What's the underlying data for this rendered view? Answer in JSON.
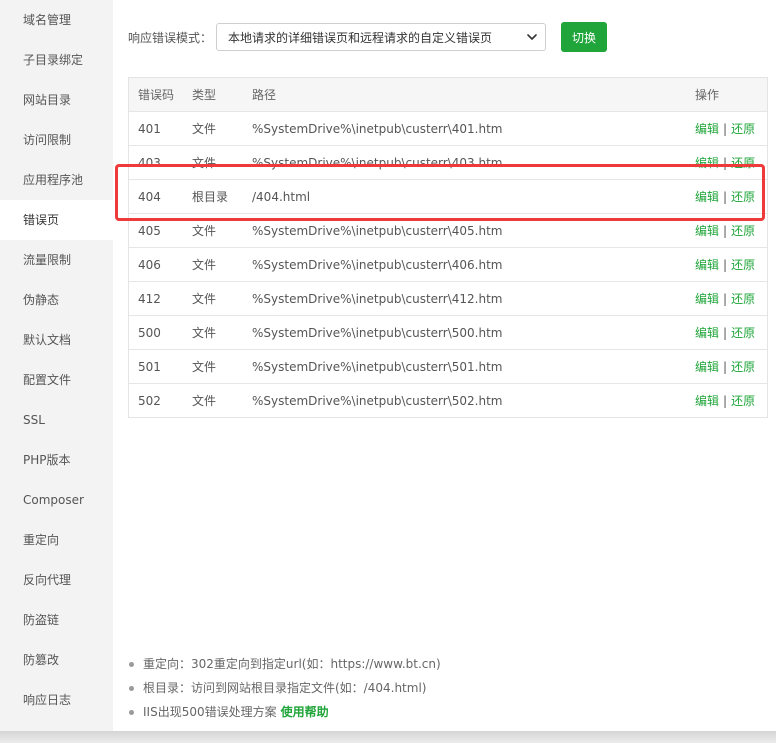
{
  "sidebar": {
    "items": [
      {
        "label": "域名管理"
      },
      {
        "label": "子目录绑定"
      },
      {
        "label": "网站目录"
      },
      {
        "label": "访问限制"
      },
      {
        "label": "应用程序池"
      },
      {
        "label": "错误页",
        "active": true
      },
      {
        "label": "流量限制"
      },
      {
        "label": "伪静态"
      },
      {
        "label": "默认文档"
      },
      {
        "label": "配置文件"
      },
      {
        "label": "SSL"
      },
      {
        "label": "PHP版本"
      },
      {
        "label": "Composer"
      },
      {
        "label": "重定向"
      },
      {
        "label": "反向代理"
      },
      {
        "label": "防盗链"
      },
      {
        "label": "防篡改"
      },
      {
        "label": "响应日志"
      }
    ]
  },
  "mode": {
    "label": "响应错误模式：",
    "selected": "本地请求的详细错误页和远程请求的自定义错误页",
    "switch_label": "切换"
  },
  "table": {
    "headers": {
      "code": "错误码",
      "type": "类型",
      "path": "路径",
      "op": "操作"
    },
    "edit_label": "编辑",
    "restore_label": "还原",
    "separator": "|",
    "rows": [
      {
        "code": "401",
        "type": "文件",
        "path": "%SystemDrive%\\inetpub\\custerr\\401.htm"
      },
      {
        "code": "403",
        "type": "文件",
        "path": "%SystemDrive%\\inetpub\\custerr\\403.htm"
      },
      {
        "code": "404",
        "type": "根目录",
        "path": "/404.html"
      },
      {
        "code": "405",
        "type": "文件",
        "path": "%SystemDrive%\\inetpub\\custerr\\405.htm"
      },
      {
        "code": "406",
        "type": "文件",
        "path": "%SystemDrive%\\inetpub\\custerr\\406.htm"
      },
      {
        "code": "412",
        "type": "文件",
        "path": "%SystemDrive%\\inetpub\\custerr\\412.htm"
      },
      {
        "code": "500",
        "type": "文件",
        "path": "%SystemDrive%\\inetpub\\custerr\\500.htm"
      },
      {
        "code": "501",
        "type": "文件",
        "path": "%SystemDrive%\\inetpub\\custerr\\501.htm"
      },
      {
        "code": "502",
        "type": "文件",
        "path": "%SystemDrive%\\inetpub\\custerr\\502.htm"
      }
    ]
  },
  "notes": {
    "redirect": "重定向：302重定向到指定url(如：https://www.bt.cn)",
    "root": "根目录：访问到网站根目录指定文件(如：/404.html)",
    "iis": "IIS出现500错误处理方案",
    "help_link": "使用帮助"
  },
  "colors": {
    "accent": "#20a53a",
    "highlight": "#ee3a3a"
  },
  "icons": {
    "select": "chevron-down-icon"
  }
}
